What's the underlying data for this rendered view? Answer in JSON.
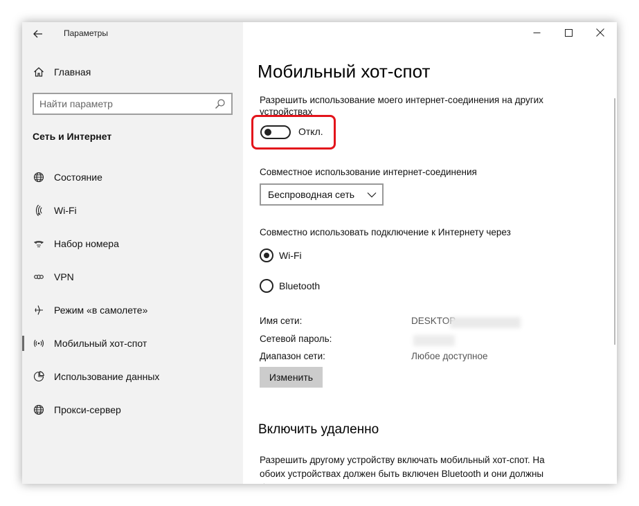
{
  "window": {
    "title": "Параметры",
    "controls": {
      "minimize": "minimize",
      "maximize": "maximize",
      "close": "close"
    }
  },
  "sidebar": {
    "home_label": "Главная",
    "search": {
      "placeholder": "Найти параметр"
    },
    "section_title": "Сеть и Интернет",
    "items": [
      {
        "label": "Состояние",
        "icon": "globe-icon"
      },
      {
        "label": "Wi-Fi",
        "icon": "wifi-icon"
      },
      {
        "label": "Набор номера",
        "icon": "dialup-icon"
      },
      {
        "label": "VPN",
        "icon": "vpn-icon"
      },
      {
        "label": "Режим «в самолете»",
        "icon": "airplane-icon"
      },
      {
        "label": "Мобильный хот-спот",
        "icon": "hotspot-icon",
        "active": true
      },
      {
        "label": "Использование данных",
        "icon": "data-usage-icon"
      },
      {
        "label": "Прокси-сервер",
        "icon": "globe-icon"
      }
    ]
  },
  "main": {
    "title": "Мобильный хот-спот",
    "share_description": "Разрешить использование моего интернет-соединения на других устройствах",
    "toggle": {
      "state_label": "Откл.",
      "on": false
    },
    "share_from": {
      "label": "Совместное использование интернет-соединения",
      "selected": "Беспроводная сеть"
    },
    "share_over": {
      "label": "Совместно использовать подключение к Интернету через",
      "options": [
        {
          "label": "Wi-Fi",
          "selected": true
        },
        {
          "label": "Bluetooth",
          "selected": false
        }
      ]
    },
    "properties": {
      "network_name_label": "Имя сети:",
      "network_name_value": "DESKTOP-",
      "password_label": "Сетевой пароль:",
      "band_label": "Диапазон сети:",
      "band_value": "Любое доступное"
    },
    "edit_button": "Изменить",
    "remote": {
      "title": "Включить удаленно",
      "description": "Разрешить другому устройству включать мобильный хот-спот. На обоих устройствах должен быть включен Bluetooth и они должны быть"
    }
  },
  "colors": {
    "highlight": "#e3141b",
    "sidebar_bg": "#f2f2f2",
    "button_bg": "#cccccc"
  }
}
